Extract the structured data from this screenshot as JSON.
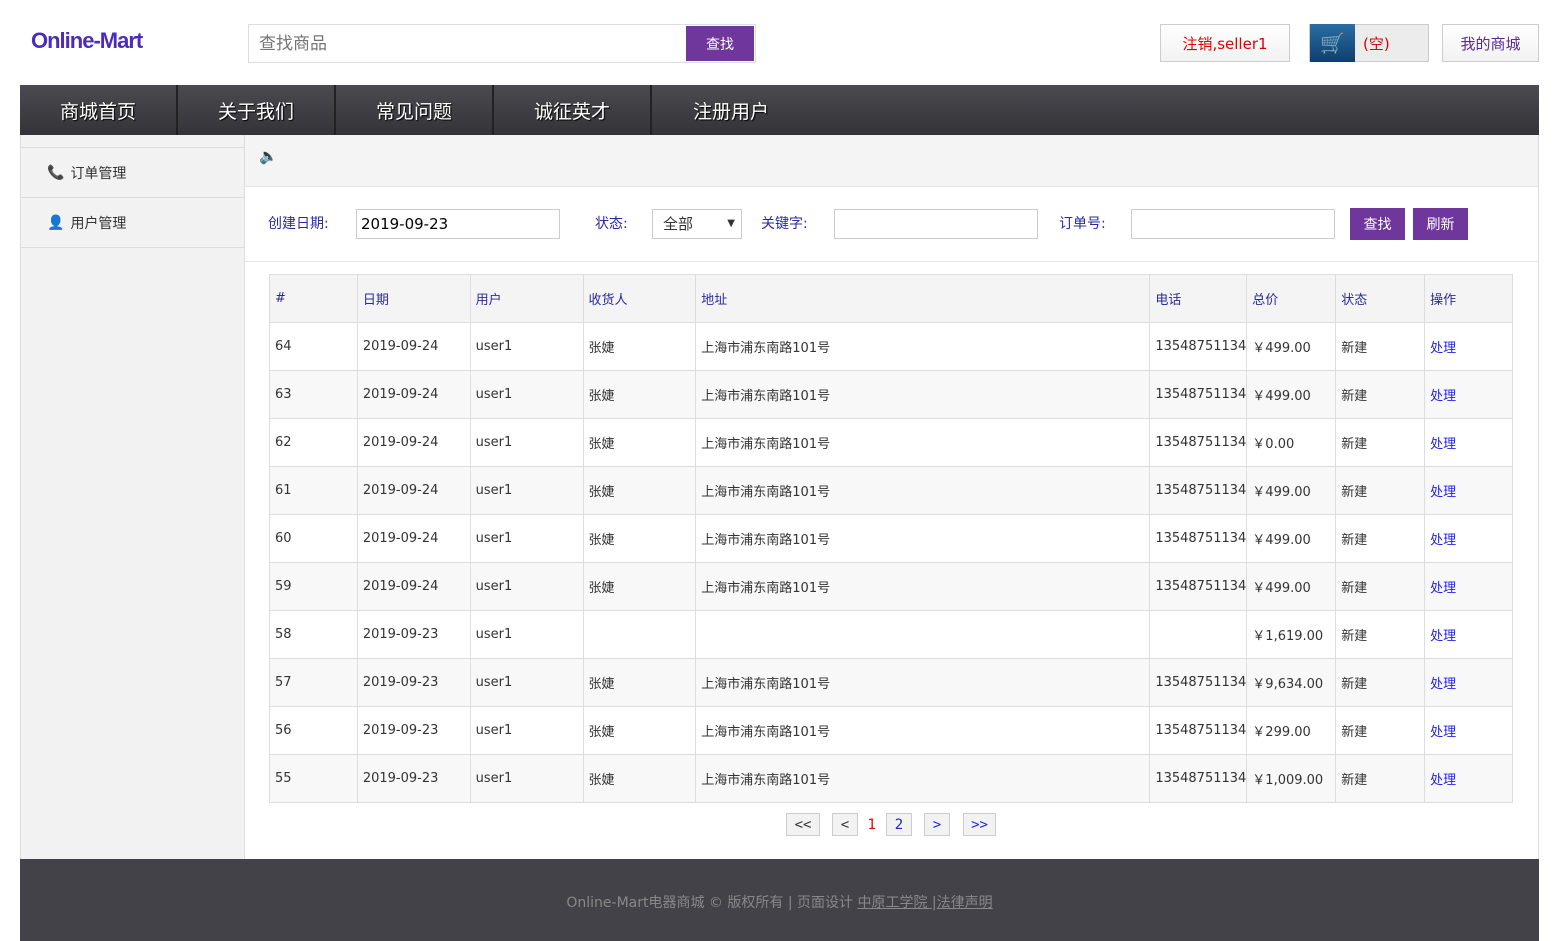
{
  "header": {
    "logo": "Online-Mart",
    "search_placeholder": "查找商品",
    "search_button": "查找",
    "logout": "注销,seller1",
    "cart": "(空)",
    "my_mall": "我的商城"
  },
  "nav": [
    "商城首页",
    "关于我们",
    "常见问题",
    "诚征英才",
    "注册用户"
  ],
  "sidebar": [
    {
      "label": "订单管理",
      "icon": "phone-icon"
    },
    {
      "label": "用户管理",
      "icon": "user-icon"
    }
  ],
  "filters": {
    "date_label": "创建日期:",
    "date_value": "2019-09-23",
    "status_label": "状态:",
    "status_value": "全部",
    "keyword_label": "关键字:",
    "keyword_value": "",
    "order_label": "订单号:",
    "order_value": "",
    "search": "查找",
    "refresh": "刷新"
  },
  "table": {
    "headers": [
      "#",
      "日期",
      "用户",
      "收货人",
      "地址",
      "电话",
      "总价",
      "状态",
      "操作"
    ],
    "rows": [
      [
        "64",
        "2019-09-24",
        "user1",
        "张婕",
        "上海市浦东南路101号",
        "13548751134",
        "￥499.00",
        "新建",
        "处理"
      ],
      [
        "63",
        "2019-09-24",
        "user1",
        "张婕",
        "上海市浦东南路101号",
        "13548751134",
        "￥499.00",
        "新建",
        "处理"
      ],
      [
        "62",
        "2019-09-24",
        "user1",
        "张婕",
        "上海市浦东南路101号",
        "13548751134",
        "￥0.00",
        "新建",
        "处理"
      ],
      [
        "61",
        "2019-09-24",
        "user1",
        "张婕",
        "上海市浦东南路101号",
        "13548751134",
        "￥499.00",
        "新建",
        "处理"
      ],
      [
        "60",
        "2019-09-24",
        "user1",
        "张婕",
        "上海市浦东南路101号",
        "13548751134",
        "￥499.00",
        "新建",
        "处理"
      ],
      [
        "59",
        "2019-09-24",
        "user1",
        "张婕",
        "上海市浦东南路101号",
        "13548751134",
        "￥499.00",
        "新建",
        "处理"
      ],
      [
        "58",
        "2019-09-23",
        "user1",
        "",
        "",
        "",
        "￥1,619.00",
        "新建",
        "处理"
      ],
      [
        "57",
        "2019-09-23",
        "user1",
        "张婕",
        "上海市浦东南路101号",
        "13548751134",
        "￥9,634.00",
        "新建",
        "处理"
      ],
      [
        "56",
        "2019-09-23",
        "user1",
        "张婕",
        "上海市浦东南路101号",
        "13548751134",
        "￥299.00",
        "新建",
        "处理"
      ],
      [
        "55",
        "2019-09-23",
        "user1",
        "张婕",
        "上海市浦东南路101号",
        "13548751134",
        "￥1,009.00",
        "新建",
        "处理"
      ]
    ]
  },
  "pager": {
    "first": "<<",
    "prev": "<",
    "current": "1",
    "page2": "2",
    "next": ">",
    "last": ">>"
  },
  "footer": {
    "text": "Online-Mart电器商城 © 版权所有 | 页面设计 ",
    "link1": "中原工学院 ",
    "sep": "|",
    "link2": "法律声明"
  },
  "colors": {
    "accent": "#6f379b",
    "nav": "#3d3d42",
    "logout": "#e00000"
  }
}
